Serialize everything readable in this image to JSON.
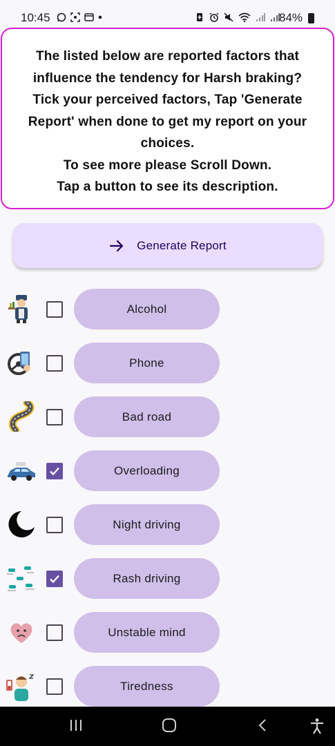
{
  "status_bar": {
    "time": "10:45",
    "battery": "84%",
    "left_icons": [
      "whatsapp-icon",
      "screenshot-icon",
      "gallery-icon",
      "dot-icon"
    ],
    "right_icons": [
      "battery-saver-icon",
      "alarm-icon",
      "mute-icon",
      "wifi-icon",
      "signal-icon",
      "signal-icon"
    ]
  },
  "info": {
    "line1": "The listed below are reported factors that",
    "line2": "influence the tendency for Harsh braking?",
    "line3": "Tick your perceived factors, Tap 'Generate",
    "line4": "Report' when done to get my report on your",
    "line5": "choices.",
    "line6": "To see more please Scroll Down.",
    "line7": "Tap a button to see its description."
  },
  "generate_button": {
    "label": "Generate Report",
    "icon": "arrow-right-icon"
  },
  "factors": [
    {
      "label": "Alcohol",
      "checked": false,
      "icon": "alcohol-waiter-icon"
    },
    {
      "label": "Phone",
      "checked": false,
      "icon": "phone-driving-icon"
    },
    {
      "label": "Bad road",
      "checked": false,
      "icon": "winding-road-icon"
    },
    {
      "label": "Overloading",
      "checked": true,
      "icon": "overloaded-car-icon"
    },
    {
      "label": "Night driving",
      "checked": false,
      "icon": "crescent-moon-icon"
    },
    {
      "label": "Rash driving",
      "checked": true,
      "icon": "rash-cars-icon"
    },
    {
      "label": "Unstable mind",
      "checked": false,
      "icon": "sad-heart-icon"
    },
    {
      "label": "Tiredness",
      "checked": false,
      "icon": "tired-person-icon"
    }
  ],
  "colors": {
    "accent": "#6750a4",
    "info_border": "#d61fd2",
    "pill": "#d0bfe8",
    "generate_bg": "#eaddff"
  }
}
